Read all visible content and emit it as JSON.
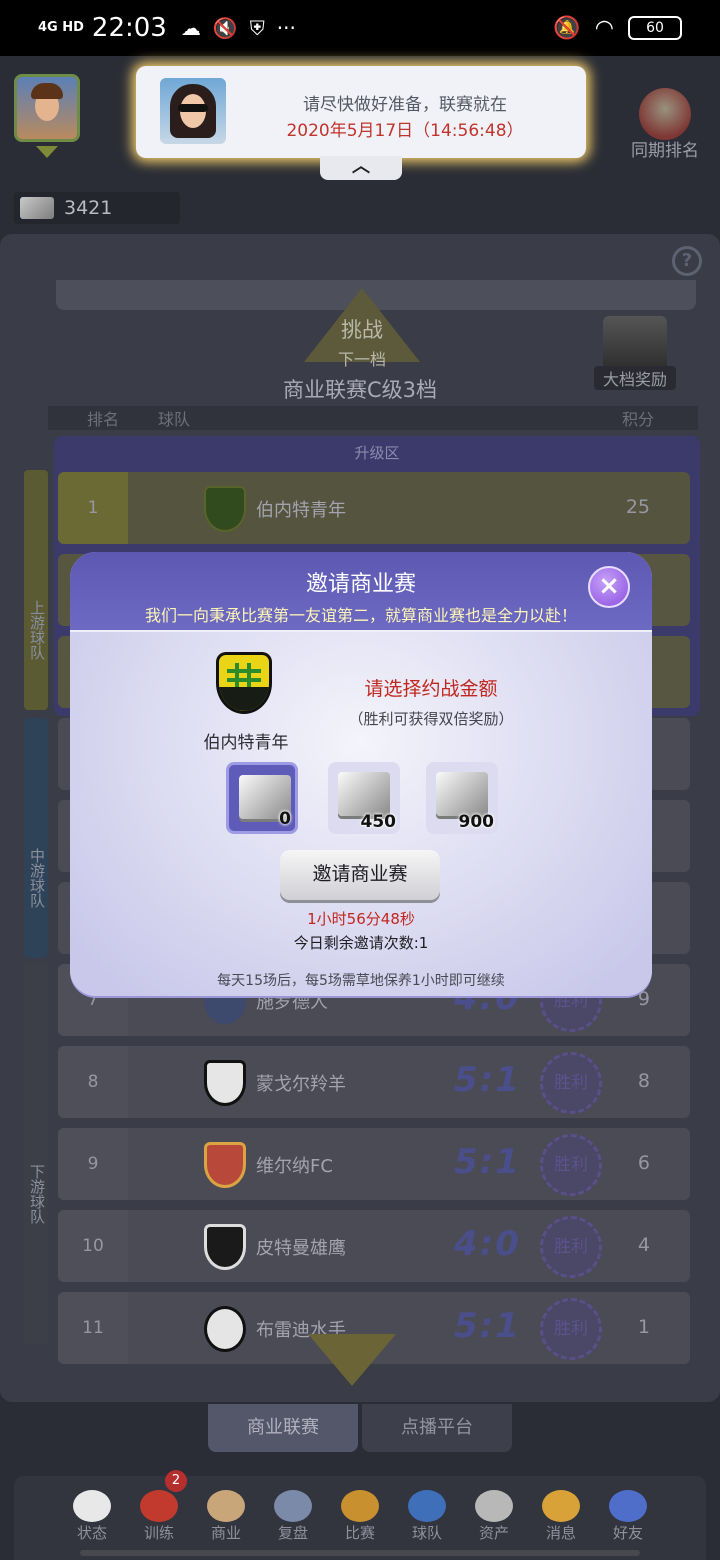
{
  "status_bar": {
    "network": "4G HD",
    "time": "22:03",
    "battery": "60"
  },
  "header": {
    "money": "3421",
    "rank_button": "同期排名"
  },
  "notification": {
    "line1": "请尽快做好准备，联赛就在",
    "line2": "2020年5月17日（14:56:48）",
    "collapse_glyph": "︿"
  },
  "league": {
    "challenge_line1": "挑战",
    "challenge_line2": "下一档",
    "title": "商业联赛C级3档",
    "big_reward": "大档奖励",
    "columns": {
      "rank": "排名",
      "team": "球队",
      "points": "积分"
    },
    "upgrade_zone": "升级区",
    "side_labels": {
      "upper": "上游球队",
      "middle": "中游球队",
      "lower": "下游球队"
    },
    "rows": [
      {
        "rank": "1",
        "team": "伯内特青年",
        "score": "",
        "stamp": "",
        "points": "25"
      },
      {
        "rank": "7",
        "team": "施罗德人",
        "score": "4:0",
        "stamp": "胜利",
        "points": "9"
      },
      {
        "rank": "8",
        "team": "蒙戈尔羚羊",
        "score": "5:1",
        "stamp": "胜利",
        "points": "8"
      },
      {
        "rank": "9",
        "team": "维尔纳FC",
        "score": "5:1",
        "stamp": "胜利",
        "points": "6"
      },
      {
        "rank": "10",
        "team": "皮特曼雄鹰",
        "score": "4:0",
        "stamp": "胜利",
        "points": "4"
      },
      {
        "rank": "11",
        "team": "布雷迪水手",
        "score": "5:1",
        "stamp": "胜利",
        "points": "1"
      }
    ],
    "tabs": [
      "商业联赛",
      "点播平台"
    ]
  },
  "modal": {
    "title": "邀请商业赛",
    "subtitle": "我们一向秉承比赛第一友谊第二，就算商业赛也是全力以赴！",
    "close": "×",
    "team_name": "伯内特青年",
    "amount_title": "请选择约战金额",
    "amount_note": "（胜利可获得双倍奖励）",
    "amounts": [
      "0",
      "450",
      "900"
    ],
    "invite_button": "邀请商业赛",
    "timer": "1小时56分48秒",
    "remaining": "今日剩余邀请次数:1",
    "footer": "每天15场后，每5场需草地保养1小时即可继续"
  },
  "bottom_nav": {
    "items": [
      "状态",
      "训练",
      "商业",
      "复盘",
      "比赛",
      "球队",
      "资产",
      "消息",
      "好友"
    ],
    "training_badge": "2"
  },
  "colors": {
    "modal_header": "#5d59b3",
    "accent_red": "#c2271f",
    "selected_amount": "#5f5cb9"
  }
}
